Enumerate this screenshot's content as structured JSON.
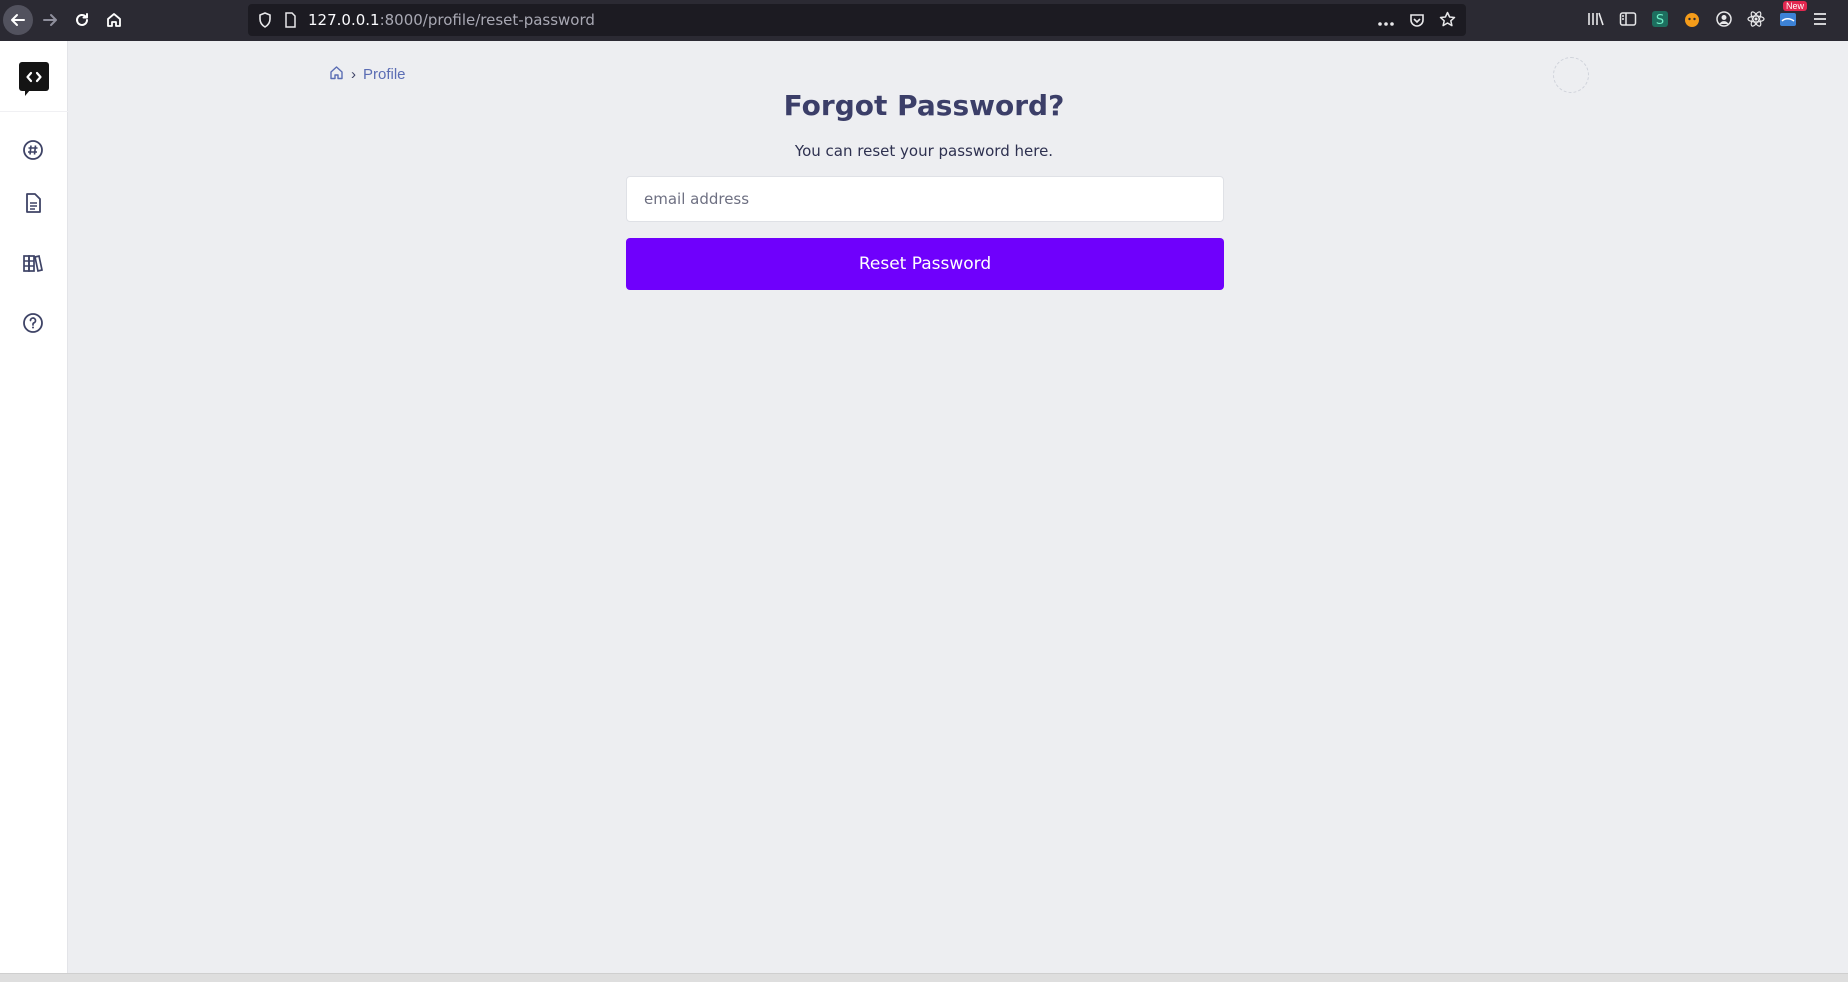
{
  "browser": {
    "url_host": "127.0.0.1",
    "url_path": ":8000/profile/reset-password",
    "new_badge": "New"
  },
  "sidebar": {
    "items": [
      {
        "icon": "hashtag-icon"
      },
      {
        "icon": "document-icon"
      },
      {
        "icon": "library-icon"
      },
      {
        "icon": "help-icon"
      }
    ]
  },
  "breadcrumb": {
    "separator": "›",
    "current": "Profile"
  },
  "page": {
    "title": "Forgot Password?",
    "subtitle": "You can reset your password here.",
    "email_placeholder": "email address",
    "email_value": "",
    "submit_label": "Reset Password"
  },
  "colors": {
    "accent": "#6f00fc",
    "heading": "#3b3e68",
    "breadcrumb_link": "#5b6db4",
    "page_bg": "#edeef1"
  }
}
